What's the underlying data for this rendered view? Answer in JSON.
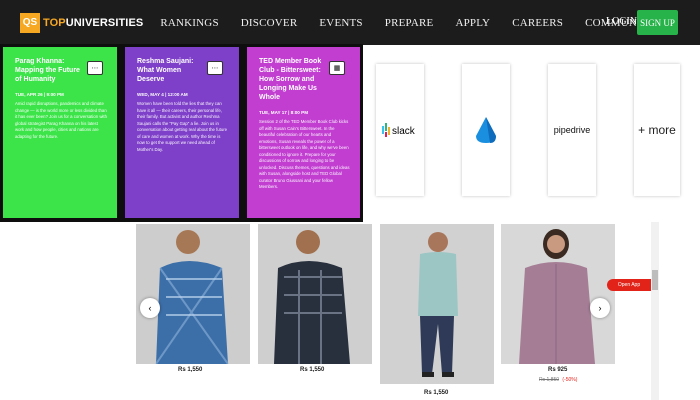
{
  "nav": {
    "logo_mark": "QS",
    "logo_prefix": "TOP",
    "logo_suffix": "UNIVERSITIES",
    "links": [
      "RANKINGS",
      "DISCOVER",
      "EVENTS",
      "PREPARE",
      "APPLY",
      "CAREERS",
      "COMMUNITY"
    ],
    "login": "LOGIN",
    "signup": "SIGN UP"
  },
  "events": [
    {
      "title": "Parag Khanna: Mapping the Future of Humanity",
      "date": "TUE, APR 26 | 9:00 PM",
      "text": "Amid rapid disruptions, pandemics and climate change — is the world more or less divided than it has ever been? Join us for a conversation with global strategist Parag Khanna on his latest work and how people, cities and nations are adapting for the future.",
      "color": "#3ce44a"
    },
    {
      "title": "Reshma Saujani: What Women Deserve",
      "date": "WED, MAY 4 | 12:00 AM",
      "text": "Women have been told the lies that they can have it all — their careers, their personal life, their family. But activist and author Reshma Saujani calls the \"Pay Gap\" a lie. Join us in conversation about getting real about the future of care and women at work. Why the time is now to get the support we need ahead of Mother's Day.",
      "color": "#7e3fc9"
    },
    {
      "title": "TED Member Book Club - Bittersweet: How Sorrow and Longing Make Us Whole",
      "date": "TUE, MAY 17 | 8:00 PM",
      "text": "Session 2 of the TED Member Book Club kicks off with Susan Cain's Bittersweet. In the beautiful celebration of our hearts and emotions, Susan reveals the power of a bittersweet outlook on life, and why we've been conditioned to ignore it. Prepare for your discussions of sorrow and longing to be unlocked. Discuss themes, questions and ideas with Susan, alongside host and TED Global curator Bruno Giussani and your fellow Members.",
      "color": "#c13ed1"
    }
  ],
  "apps": [
    {
      "name": "slack",
      "label": "slack"
    },
    {
      "name": "azure",
      "label": ""
    },
    {
      "name": "pipedrive",
      "label": "pipedrive"
    },
    {
      "name": "more",
      "label": "+ more"
    }
  ],
  "products": [
    {
      "price": "Rs 1,550",
      "old_price": "",
      "discount": ""
    },
    {
      "price": "Rs 1,550",
      "old_price": "",
      "discount": ""
    },
    {
      "price": "Rs 1,550",
      "old_price": "",
      "discount": ""
    },
    {
      "price": "Rs 925",
      "old_price": "Rs 1,850",
      "discount": "(-50%)"
    }
  ],
  "open_app": "Open App",
  "colors": {
    "nav_bg": "#1c1c1c",
    "accent": "#f7a823",
    "signup": "#27b24a",
    "open_app": "#e2231a"
  }
}
